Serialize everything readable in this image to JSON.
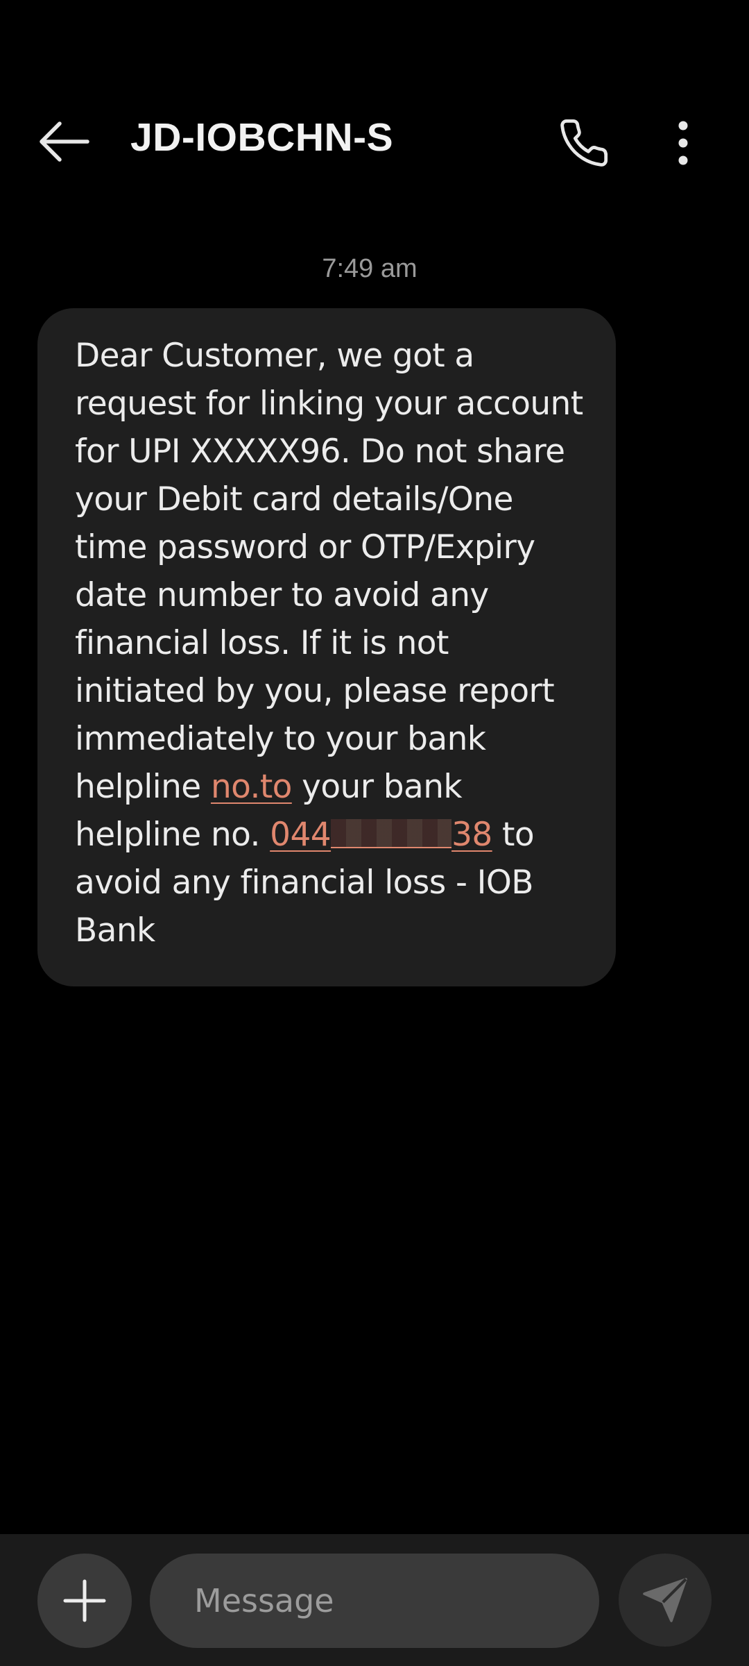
{
  "header": {
    "title": "JD-IOBCHN-S",
    "back_icon": "arrow-left-icon",
    "call_icon": "phone-icon",
    "more_icon": "more-vertical-icon"
  },
  "conversation": {
    "timestamp": "7:49 am",
    "message": {
      "text_before_link": "Dear Customer, we got a request for linking your account for UPI XXXXX96. Do not share your Debit card details/One time password or OTP/Expiry date number to avoid any financial loss. If it is not initiated by you, please report immediately to your bank helpline ",
      "link1": "no.to",
      "text_middle": " your bank helpline no. ",
      "phone_prefix": "044",
      "phone_suffix": "38",
      "text_after": " to avoid any financial loss - IOB Bank"
    }
  },
  "composer": {
    "placeholder": "Message",
    "attach_icon": "plus-icon",
    "send_icon": "send-icon"
  },
  "colors": {
    "background": "#000000",
    "bubble": "#1f1f1f",
    "link": "#e0876e",
    "composer_bar": "#1b1b1b",
    "input": "#3a3a3a"
  }
}
